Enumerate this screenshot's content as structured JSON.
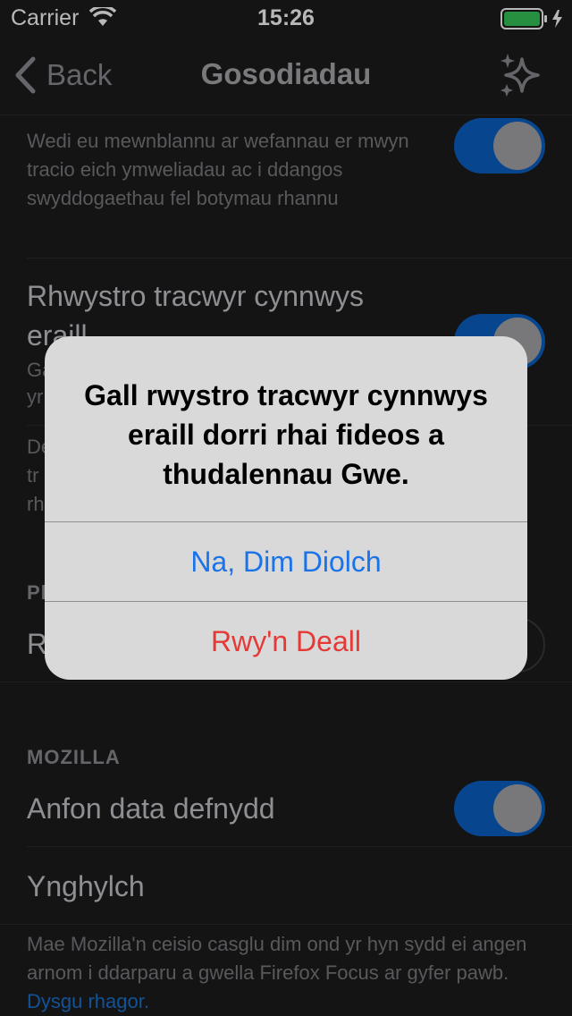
{
  "status": {
    "carrier": "Carrier",
    "time": "15:26"
  },
  "nav": {
    "back_label": "Back",
    "title": "Gosodiadau"
  },
  "trackers": {
    "social_desc": "Wedi eu mewnblannu ar wefannau er mwyn tracio eich ymweliadau ac i ddangos swyddogaethau fel botymau rhannu",
    "other_title": "Rhwystro tracwyr cynnwys eraill",
    "other_desc_partial": "Ga yr",
    "footer_partial": "De tr rh"
  },
  "section_p": {
    "header_partial": "Pl",
    "row_partial": "R"
  },
  "mozilla": {
    "header": "MOZILLA",
    "send_data": "Anfon data defnydd",
    "about": "Ynghylch",
    "footer_text": "Mae Mozilla'n ceisio casglu dim ond yr hyn sydd ei angen arnom i ddarparu a gwella Firefox Focus ar gyfer pawb.",
    "footer_link": "Dysgu rhagor."
  },
  "alert": {
    "message": "Gall rwystro tracwyr cynnwys eraill dorri rhai fideos a thudalennau Gwe.",
    "cancel": "Na, Dim Diolch",
    "confirm": "Rwy'n Deall"
  },
  "colors": {
    "accent": "#0a60c6",
    "alert_cancel": "#1a73e8",
    "alert_confirm": "#e53935"
  }
}
